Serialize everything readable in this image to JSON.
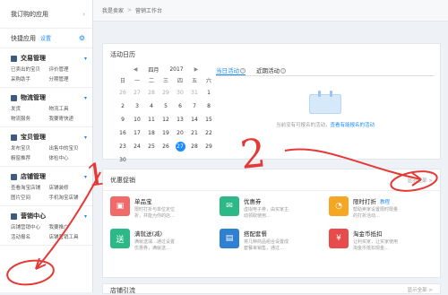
{
  "sidebar": {
    "my_apps": "我订购的应用",
    "quick_apps": "快捷应用",
    "settings": "设置",
    "sections": [
      {
        "title": "交易管理",
        "items": [
          "已卖出的宝贝",
          "评价管理",
          "采购助手",
          "分期管理"
        ]
      },
      {
        "title": "物流管理",
        "items": [
          "发货",
          "物流工具",
          "物流服务",
          "我要寄快递"
        ]
      },
      {
        "title": "宝贝管理",
        "items": [
          "发布宝贝",
          "出售中的宝贝",
          "橱窗推荐",
          "体检中心"
        ]
      },
      {
        "title": "店铺管理",
        "items": [
          "查看淘宝店铺",
          "店铺装修",
          "图片空间",
          "手机淘宝店铺"
        ]
      },
      {
        "title": "营销中心",
        "items": [
          "店铺营销中心",
          "我要推广",
          "活动报名",
          "店铺营销工具"
        ]
      }
    ]
  },
  "breadcrumb": {
    "root": "我是卖家",
    "sep": ">",
    "current": "营销工作台"
  },
  "calendar": {
    "title": "活动日历",
    "month": "四月",
    "year": "2017",
    "prev": "◀",
    "next": "▶",
    "weekdays": [
      "日",
      "一",
      "二",
      "三",
      "四",
      "五",
      "六"
    ],
    "days": [
      {
        "n": "26",
        "muted": true
      },
      {
        "n": "27",
        "muted": true
      },
      {
        "n": "28",
        "muted": true
      },
      {
        "n": "29",
        "muted": true
      },
      {
        "n": "30",
        "muted": true
      },
      {
        "n": "31",
        "muted": true
      },
      {
        "n": "1"
      },
      {
        "n": "2"
      },
      {
        "n": "3"
      },
      {
        "n": "4"
      },
      {
        "n": "5"
      },
      {
        "n": "6"
      },
      {
        "n": "7"
      },
      {
        "n": "8"
      },
      {
        "n": "9"
      },
      {
        "n": "10"
      },
      {
        "n": "11"
      },
      {
        "n": "12"
      },
      {
        "n": "13"
      },
      {
        "n": "14"
      },
      {
        "n": "15"
      },
      {
        "n": "16"
      },
      {
        "n": "17"
      },
      {
        "n": "18"
      },
      {
        "n": "19"
      },
      {
        "n": "20"
      },
      {
        "n": "21"
      },
      {
        "n": "22"
      },
      {
        "n": "23"
      },
      {
        "n": "24"
      },
      {
        "n": "25"
      },
      {
        "n": "26"
      },
      {
        "n": "27",
        "today": true
      },
      {
        "n": "28"
      },
      {
        "n": "29"
      },
      {
        "n": "30"
      }
    ]
  },
  "activity": {
    "tab_today": "当日活动",
    "tab_recent": "近期活动",
    "empty_text": "当前没有可报名的活动，",
    "empty_link": "查看有能报名的活动"
  },
  "promo": {
    "title": "优惠促销",
    "view_all": "显示全部 >",
    "tools": [
      {
        "name": "单品宝",
        "tag": "",
        "desc": [
          "限时打折与单位定位",
          "折，并能为你的店…"
        ],
        "color": "#f06a6a",
        "icon": "tag-icon"
      },
      {
        "name": "优惠券",
        "tag": "",
        "desc": [
          "虚拟电子券，由买家主",
          "动领取使用…"
        ],
        "color": "#2cb887",
        "icon": "coupon-icon"
      },
      {
        "name": "限时打折",
        "tag": "教程",
        "desc": [
          "帮助卖家设置限时限量",
          "的打折活动…"
        ],
        "color": "#f5a623",
        "icon": "clock-icon"
      },
      {
        "name": "满就送(减)",
        "tag": "",
        "desc": [
          "满就送减…通过设置",
          "优惠券，满就送…"
        ],
        "color": "#2cb887",
        "icon": "gift-icon"
      },
      {
        "name": "搭配套餐",
        "tag": "",
        "desc": [
          "将几种商品组合设置成",
          "套餐来销售，通过…"
        ],
        "color": "#2f80d1",
        "icon": "bundle-icon"
      },
      {
        "name": "淘金币抵扣",
        "tag": "",
        "desc": [
          "让利买家，让买家使用",
          "淘金币抵扣现金…"
        ],
        "color": "#e84b4b",
        "icon": "coin-icon"
      }
    ]
  },
  "lower_panel": {
    "title": "店铺引流",
    "view_all": "显示全部 >"
  },
  "annotations": {
    "label_one": "1",
    "label_two": "2"
  }
}
